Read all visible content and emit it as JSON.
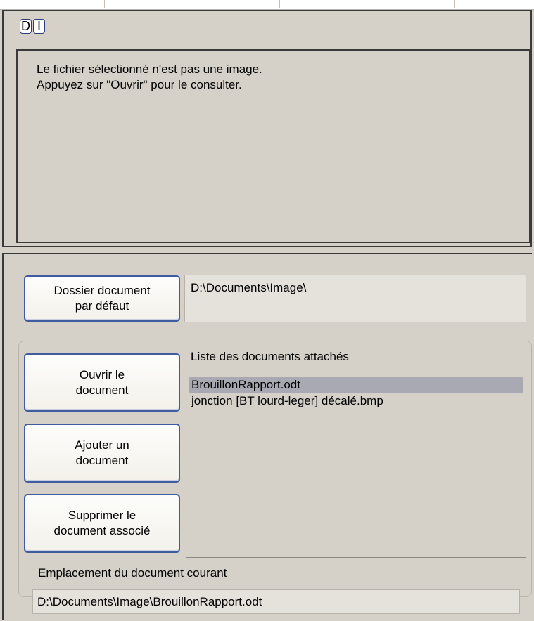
{
  "toggles": {
    "d_label": "D",
    "i_label": "I"
  },
  "preview": {
    "line1": "Le fichier sélectionné n'est pas une image.",
    "line2": "Appuyez sur \"Ouvrir\" pour le consulter."
  },
  "default_folder": {
    "button_label": "Dossier document\npar défaut",
    "path": "D:\\Documents\\Image\\"
  },
  "attached": {
    "list_label": "Liste des documents attachés",
    "items": [
      {
        "name": "BrouillonRapport.odt",
        "selected": true
      },
      {
        "name": "jonction [BT lourd-leger] décalé.bmp",
        "selected": false
      }
    ],
    "open_button": "Ouvrir le\ndocument",
    "add_button": "Ajouter un\ndocument",
    "delete_button": "Supprimer le\ndocument associé"
  },
  "current_location": {
    "label": "Emplacement du document courant",
    "path": "D:\\Documents\\Image\\BrouillonRapport.odt"
  }
}
